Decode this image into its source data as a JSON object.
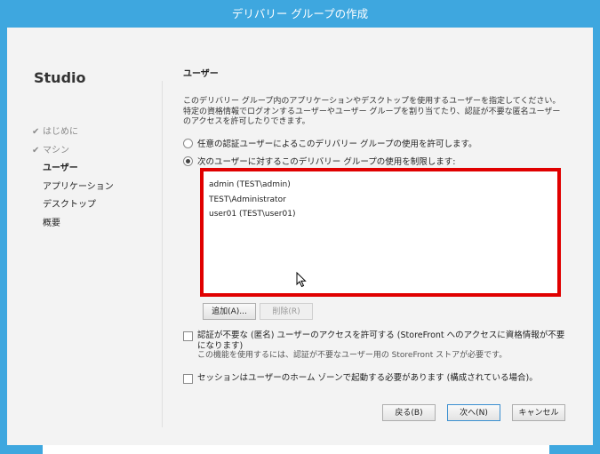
{
  "window": {
    "title": "デリバリー グループの作成"
  },
  "sidebar": {
    "brand": "Studio",
    "steps": [
      {
        "label": "はじめに",
        "state": "done"
      },
      {
        "label": "マシン",
        "state": "done"
      },
      {
        "label": "ユーザー",
        "state": "current"
      },
      {
        "label": "アプリケーション",
        "state": "pending"
      },
      {
        "label": "デスクトップ",
        "state": "pending"
      },
      {
        "label": "概要",
        "state": "pending"
      }
    ]
  },
  "main": {
    "title": "ユーザー",
    "description": "このデリバリー グループ内のアプリケーションやデスクトップを使用するユーザーを指定してください。特定の資格情報でログオンするユーザーやユーザー グループを割り当てたり、認証が不要な匿名ユーザーのアクセスを許可したりできます。",
    "radio_any": {
      "label": "任意の認証ユーザーによるこのデリバリー グループの使用を許可します。",
      "selected": false
    },
    "radio_restrict": {
      "label": "次のユーザーに対するこのデリバリー グループの使用を制限します:",
      "selected": true
    },
    "users": [
      "admin (TEST\\admin)",
      "TEST\\Administrator",
      "user01 (TEST\\user01)"
    ],
    "add_button": "追加(A)...",
    "remove_button": "削除(R)",
    "anon_checkbox": {
      "label": "認証が不要な (匿名) ユーザーのアクセスを許可する (StoreFront へのアクセスに資格情報が不要になります)",
      "note": "この機能を使用するには、認証が不要なユーザー用の StoreFront ストアが必要です。",
      "checked": false
    },
    "session_checkbox": {
      "label": "セッションはユーザーのホーム ゾーンで起動する必要があります (構成されている場合)。",
      "checked": false
    }
  },
  "footer": {
    "back": "戻る(B)",
    "next": "次へ(N)",
    "cancel": "キャンセル"
  },
  "colors": {
    "titlebar": "#3ea7df",
    "highlight": "#e00000"
  }
}
